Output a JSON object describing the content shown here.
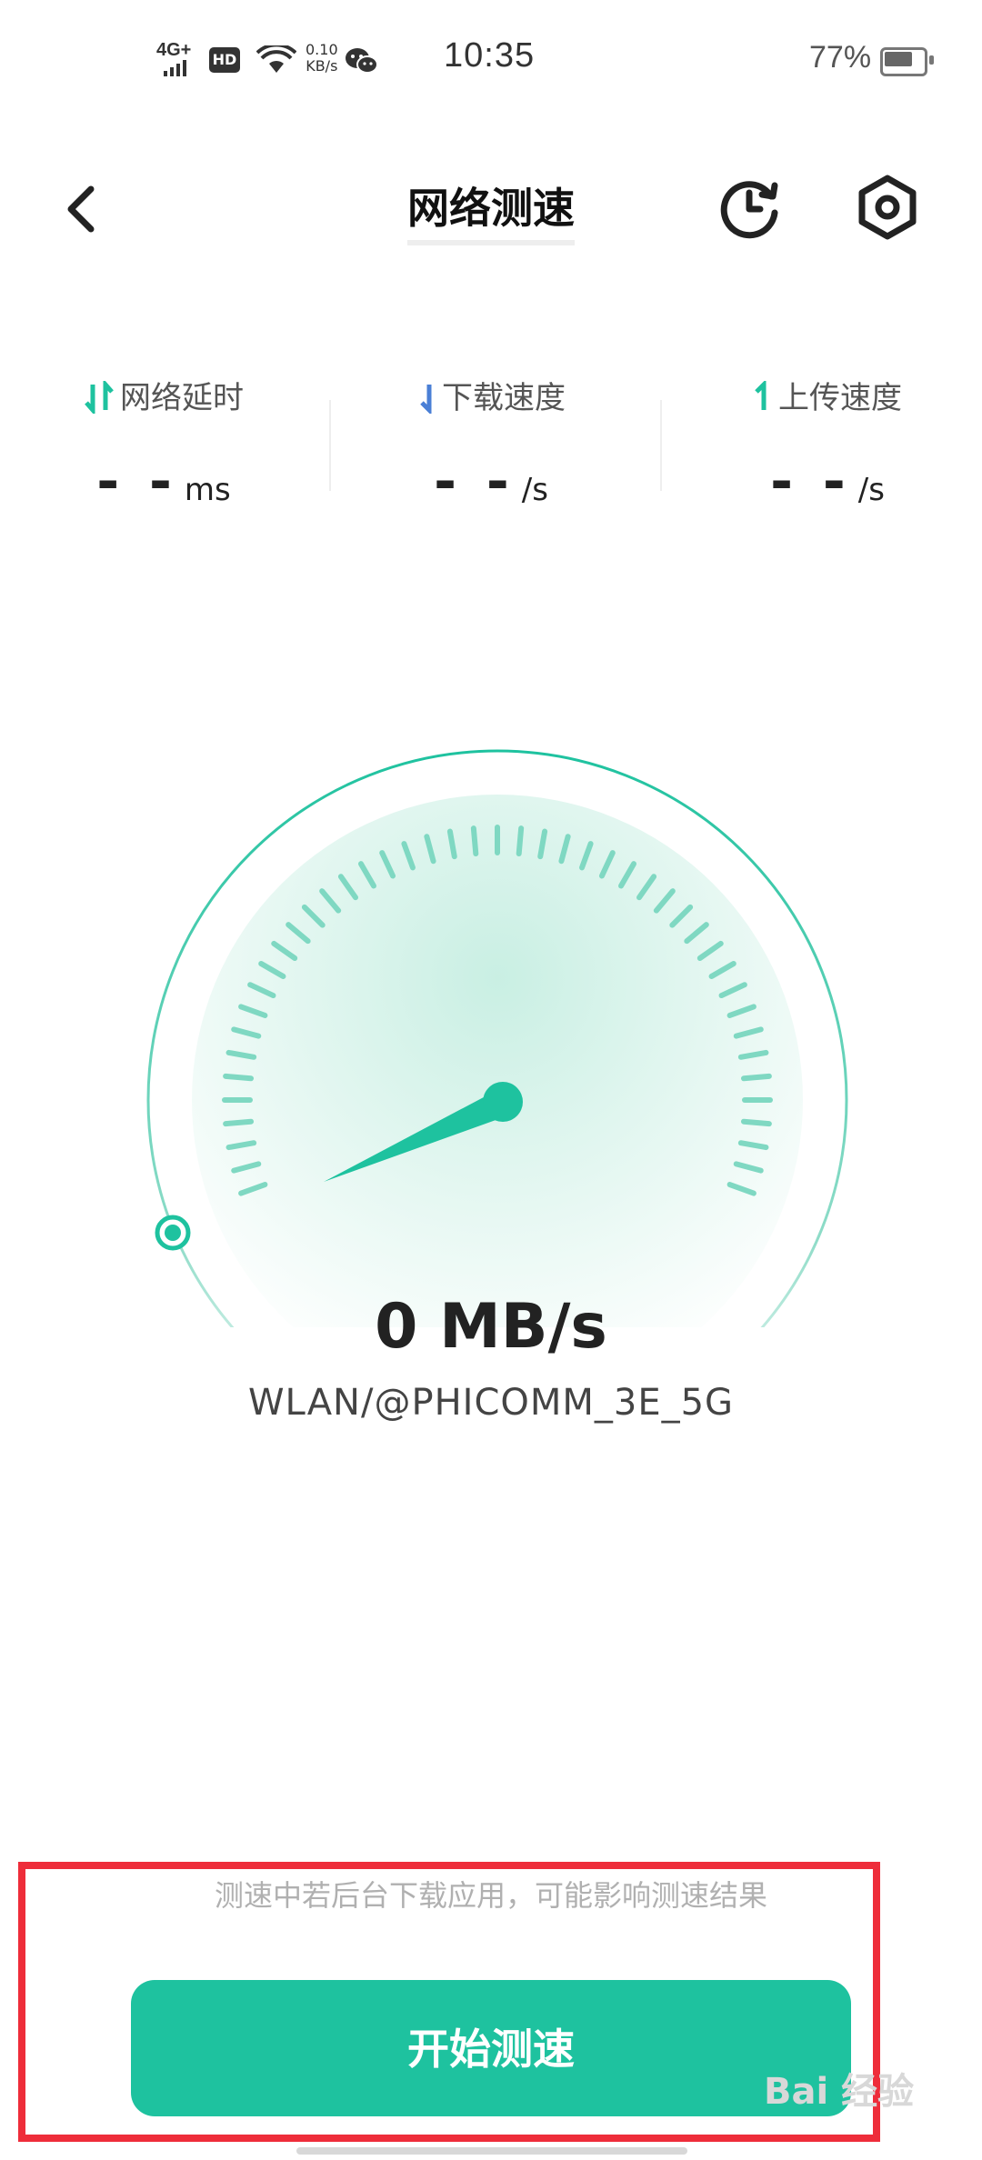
{
  "status_bar": {
    "signal": "4G+",
    "hd": "HD",
    "net_speed_value": "0.10",
    "net_speed_unit": "KB/s",
    "time": "10:35",
    "battery": "77%"
  },
  "header": {
    "title": "网络测速",
    "icons": [
      "back-icon",
      "history-icon",
      "settings-icon"
    ]
  },
  "metrics": [
    {
      "label": "网络延时",
      "value": "- -",
      "unit": "ms",
      "icon": "updown-arrows-icon",
      "color": "#1ec29f"
    },
    {
      "label": "下载速度",
      "value": "- -",
      "unit": "/s",
      "icon": "download-arrow-icon",
      "color": "#4a7fd6"
    },
    {
      "label": "上传速度",
      "value": "- -",
      "unit": "/s",
      "icon": "upload-arrow-icon",
      "color": "#1ec29f"
    }
  ],
  "gauge": {
    "speed": "0 MB/s",
    "network": "WLAN/@PHICOMM_3E_5G",
    "accent": "#1ec29f"
  },
  "hint": "测速中若后台下载应用，可能影响测速结果",
  "start_button": "开始测速",
  "watermark": "Bai 经验"
}
